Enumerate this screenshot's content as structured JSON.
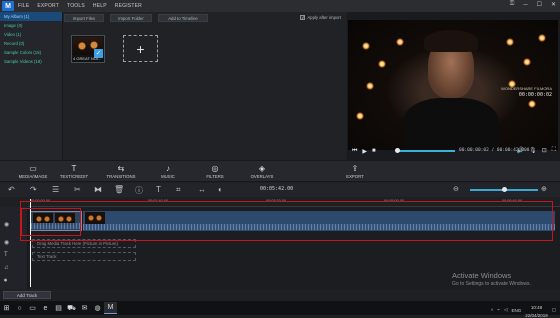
{
  "menu": {
    "items": [
      "FILE",
      "EXPORT",
      "TOOLS",
      "HELP",
      "REGISTER"
    ]
  },
  "library": {
    "items": [
      {
        "label": "My Album (1)",
        "active": true
      },
      {
        "label": "Image (0)",
        "active": false
      },
      {
        "label": "Video (1)",
        "active": false
      },
      {
        "label": "Record (0)",
        "active": false
      },
      {
        "label": "Sample Colors (15)",
        "active": false
      },
      {
        "label": "Sample Videos (18)",
        "active": false
      }
    ]
  },
  "media": {
    "import_files": "Import Files",
    "import_folder": "Import Folder",
    "add_to_timeline": "Add to Timeline",
    "apply_after_import": "Apply after import",
    "thumb_caption": "4 GREAT NOI...",
    "add_icon": "plus-icon"
  },
  "preview": {
    "watermark": "WONDERSHARE FILMORA",
    "top_time": "00:00:00:02",
    "time_display": "00:00:00:02 / 00:00:42:000",
    "progress": 0.08
  },
  "effects": [
    {
      "label": "MEDIA/IMAGE",
      "icon": "folder-icon"
    },
    {
      "label": "TEXT/CREDIT",
      "icon": "text-icon"
    },
    {
      "label": "TRANSITIONS",
      "icon": "transitions-icon"
    },
    {
      "label": "MUSIC",
      "icon": "music-icon"
    },
    {
      "label": "FILTERS",
      "icon": "filters-icon"
    },
    {
      "label": "OVERLAYS",
      "icon": "overlays-icon"
    },
    {
      "label": "EXPORT",
      "icon": "export-icon"
    }
  ],
  "timeline": {
    "timecode": "00:05:42.00",
    "ruler": [
      "00:00:00.00",
      "00:01:40.00",
      "00:03:20.00",
      "00:05:00.00",
      "00:06:40.00"
    ],
    "pip_track": "Drag Media Track Here (Picture in Picture)",
    "text_track": "Text Track",
    "zoom_level": 0.47
  },
  "watermark": {
    "title": "Activate Windows",
    "subtitle": "Go to Settings to activate Windows."
  },
  "add_track": "Add Track",
  "taskbar": {
    "lang": "ENG",
    "time": "10:48",
    "date": "22/04/2019"
  }
}
